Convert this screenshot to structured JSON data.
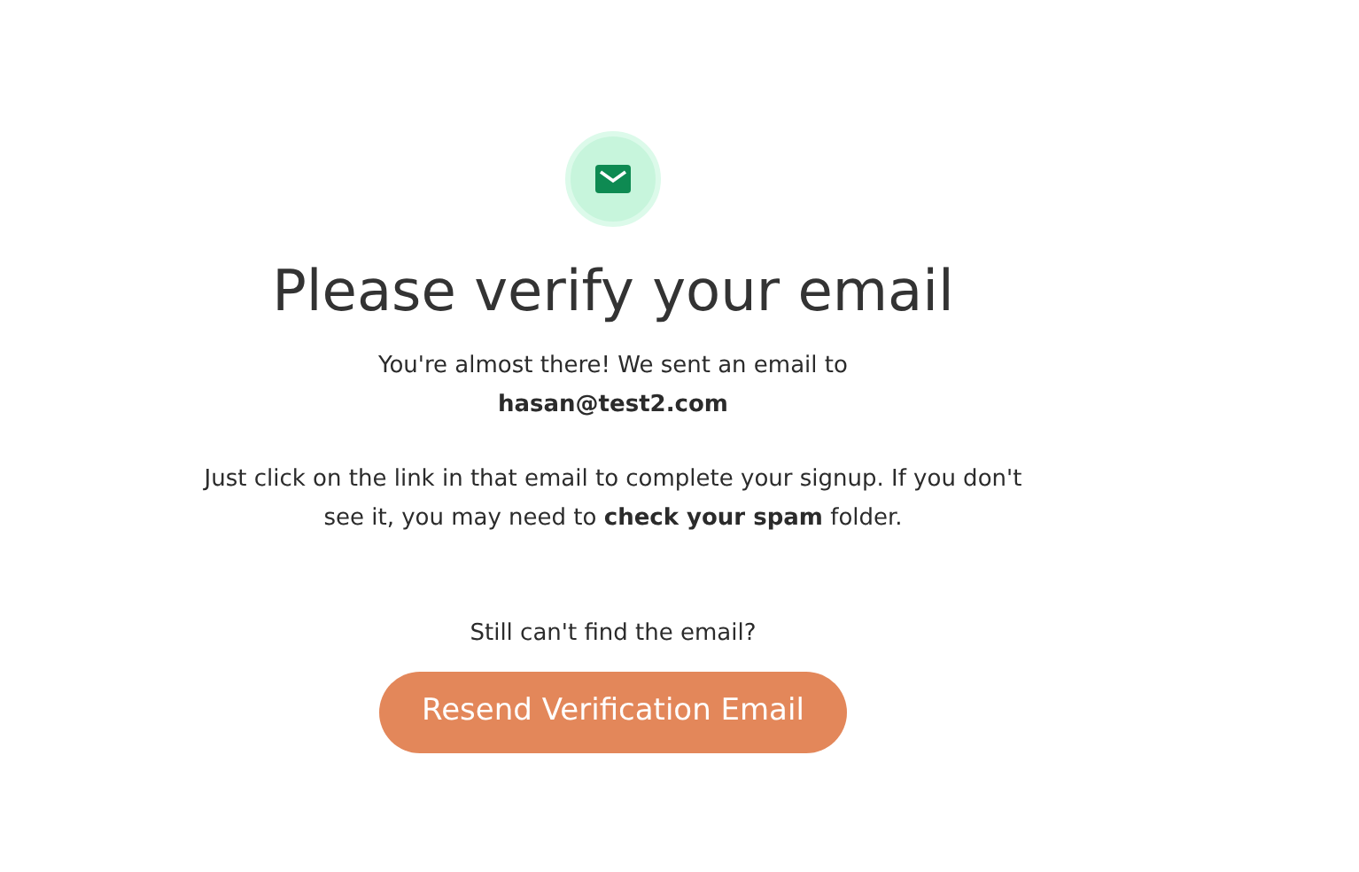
{
  "title": "Please verify your email",
  "intro": "You're almost there! We sent an email to",
  "email": "hasan@test2.com",
  "instructions": "Just click on the link in that email to complete your signup. If you don't see it, you may need to **check your spam** folder.",
  "prompt": "Still can't find the email?",
  "button": {
    "label": "Resend Verification Email"
  }
}
